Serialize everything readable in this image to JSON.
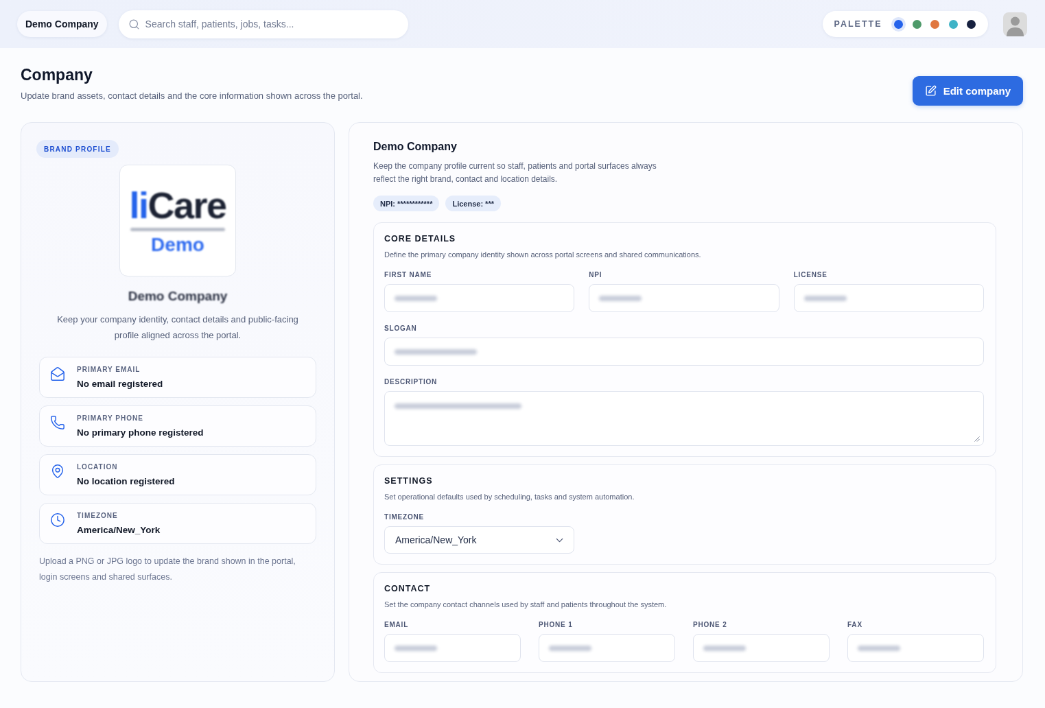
{
  "topbar": {
    "company": "Demo Company",
    "search": {
      "placeholder": "Search staff, patients, jobs, tasks..."
    },
    "palette": {
      "label": "PALETTE",
      "swatches": [
        {
          "color": "#2563eb",
          "selected": true
        },
        {
          "color": "#4f9a6a",
          "selected": false
        },
        {
          "color": "#e0773f",
          "selected": false
        },
        {
          "color": "#3fb3c6",
          "selected": false
        },
        {
          "color": "#17213f",
          "selected": false
        }
      ]
    }
  },
  "header": {
    "title": "Company",
    "subtitle": "Update brand assets, contact details and the core information shown across the portal.",
    "action": "Edit company"
  },
  "brand_profile": {
    "badge": "BRAND PROFILE",
    "logo": {
      "wordmark": [
        {
          "text": "li",
          "color": "#2563eb"
        },
        {
          "text": "Care",
          "color": "#1c2233"
        }
      ],
      "caption": "Demo"
    },
    "name": "Demo Company",
    "description": "Keep your company identity, contact details and public-facing profile aligned across the portal.",
    "items": [
      {
        "kind": "email",
        "label": "PRIMARY EMAIL",
        "value": "No email registered"
      },
      {
        "kind": "phone",
        "label": "PRIMARY PHONE",
        "value": "No primary phone registered"
      },
      {
        "kind": "location",
        "label": "LOCATION",
        "value": "No location registered"
      },
      {
        "kind": "timezone",
        "label": "TIMEZONE",
        "value": "America/New_York"
      }
    ],
    "note": "Upload a PNG or JPG logo to update the brand shown in the portal, login screens and shared surfaces."
  },
  "company": {
    "title": "Demo Company",
    "description": "Keep the company profile current so staff, patients and portal surfaces always reflect the right brand, contact and location details.",
    "chips": [
      "NPI: ************",
      "License: ***"
    ],
    "sections": [
      {
        "title": "CORE DETAILS",
        "description": "Define the primary company identity shown across portal screens and shared communications.",
        "rows": [
          [
            {
              "label": "FIRST NAME",
              "kind": "text",
              "blurred": true
            },
            {
              "label": "NPI",
              "kind": "text",
              "blurred": true
            },
            {
              "label": "LICENSE",
              "kind": "text",
              "blurred": true
            }
          ],
          [
            {
              "label": "SLOGAN",
              "kind": "text",
              "blurred": true
            }
          ],
          [
            {
              "label": "DESCRIPTION",
              "kind": "textarea",
              "blurred": true
            }
          ]
        ]
      },
      {
        "title": "SETTINGS",
        "description": "Set operational defaults used by scheduling, tasks and system automation.",
        "rows": [
          [
            {
              "label": "TIMEZONE",
              "kind": "select",
              "value": "America/New_York"
            }
          ]
        ]
      },
      {
        "title": "CONTACT",
        "description": "Set the company contact channels used by staff and patients throughout the system.",
        "rows": [
          [
            {
              "label": "EMAIL",
              "kind": "text",
              "blurred": true
            },
            {
              "label": "PHONE 1",
              "kind": "text",
              "blurred": true
            },
            {
              "label": "PHONE 2",
              "kind": "text",
              "blurred": true
            },
            {
              "label": "FAX",
              "kind": "text",
              "blurred": true
            }
          ]
        ]
      }
    ]
  }
}
